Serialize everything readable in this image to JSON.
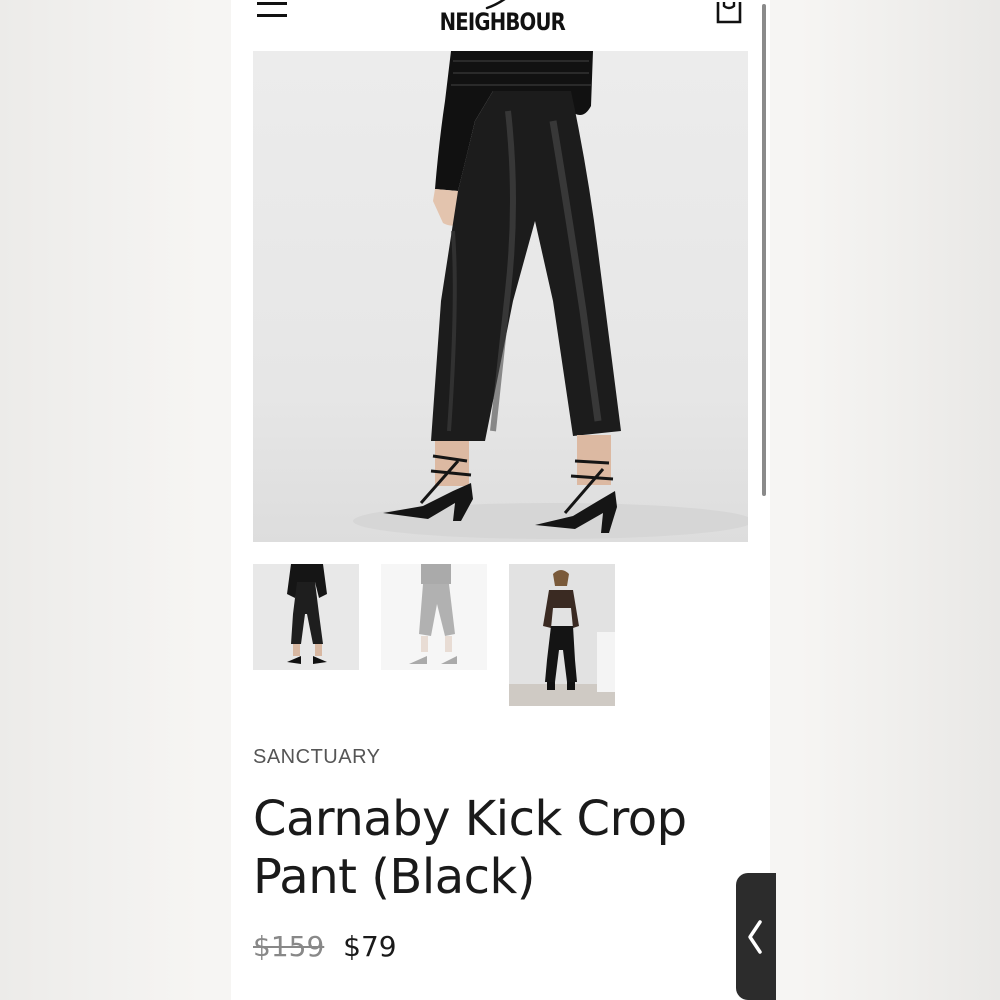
{
  "header": {
    "logo_text": "NEIGHBOUR"
  },
  "icons": {
    "menu": "hamburger-menu-icon",
    "bag": "shopping-bag-icon",
    "side_tab": "chevron-left-icon"
  },
  "gallery": {
    "main_image": "product-photo-back-view",
    "thumbnails": [
      "product-thumbnail-front",
      "product-thumbnail-back",
      "product-thumbnail-model-front"
    ]
  },
  "product": {
    "brand": "SANCTUARY",
    "title": "Carnaby Kick Crop Pant (Black)",
    "price_original": "$159",
    "price_sale": "$79"
  },
  "colors": {
    "text": "#1a1a1a",
    "muted": "#888888",
    "tab": "#2c2c2c"
  }
}
